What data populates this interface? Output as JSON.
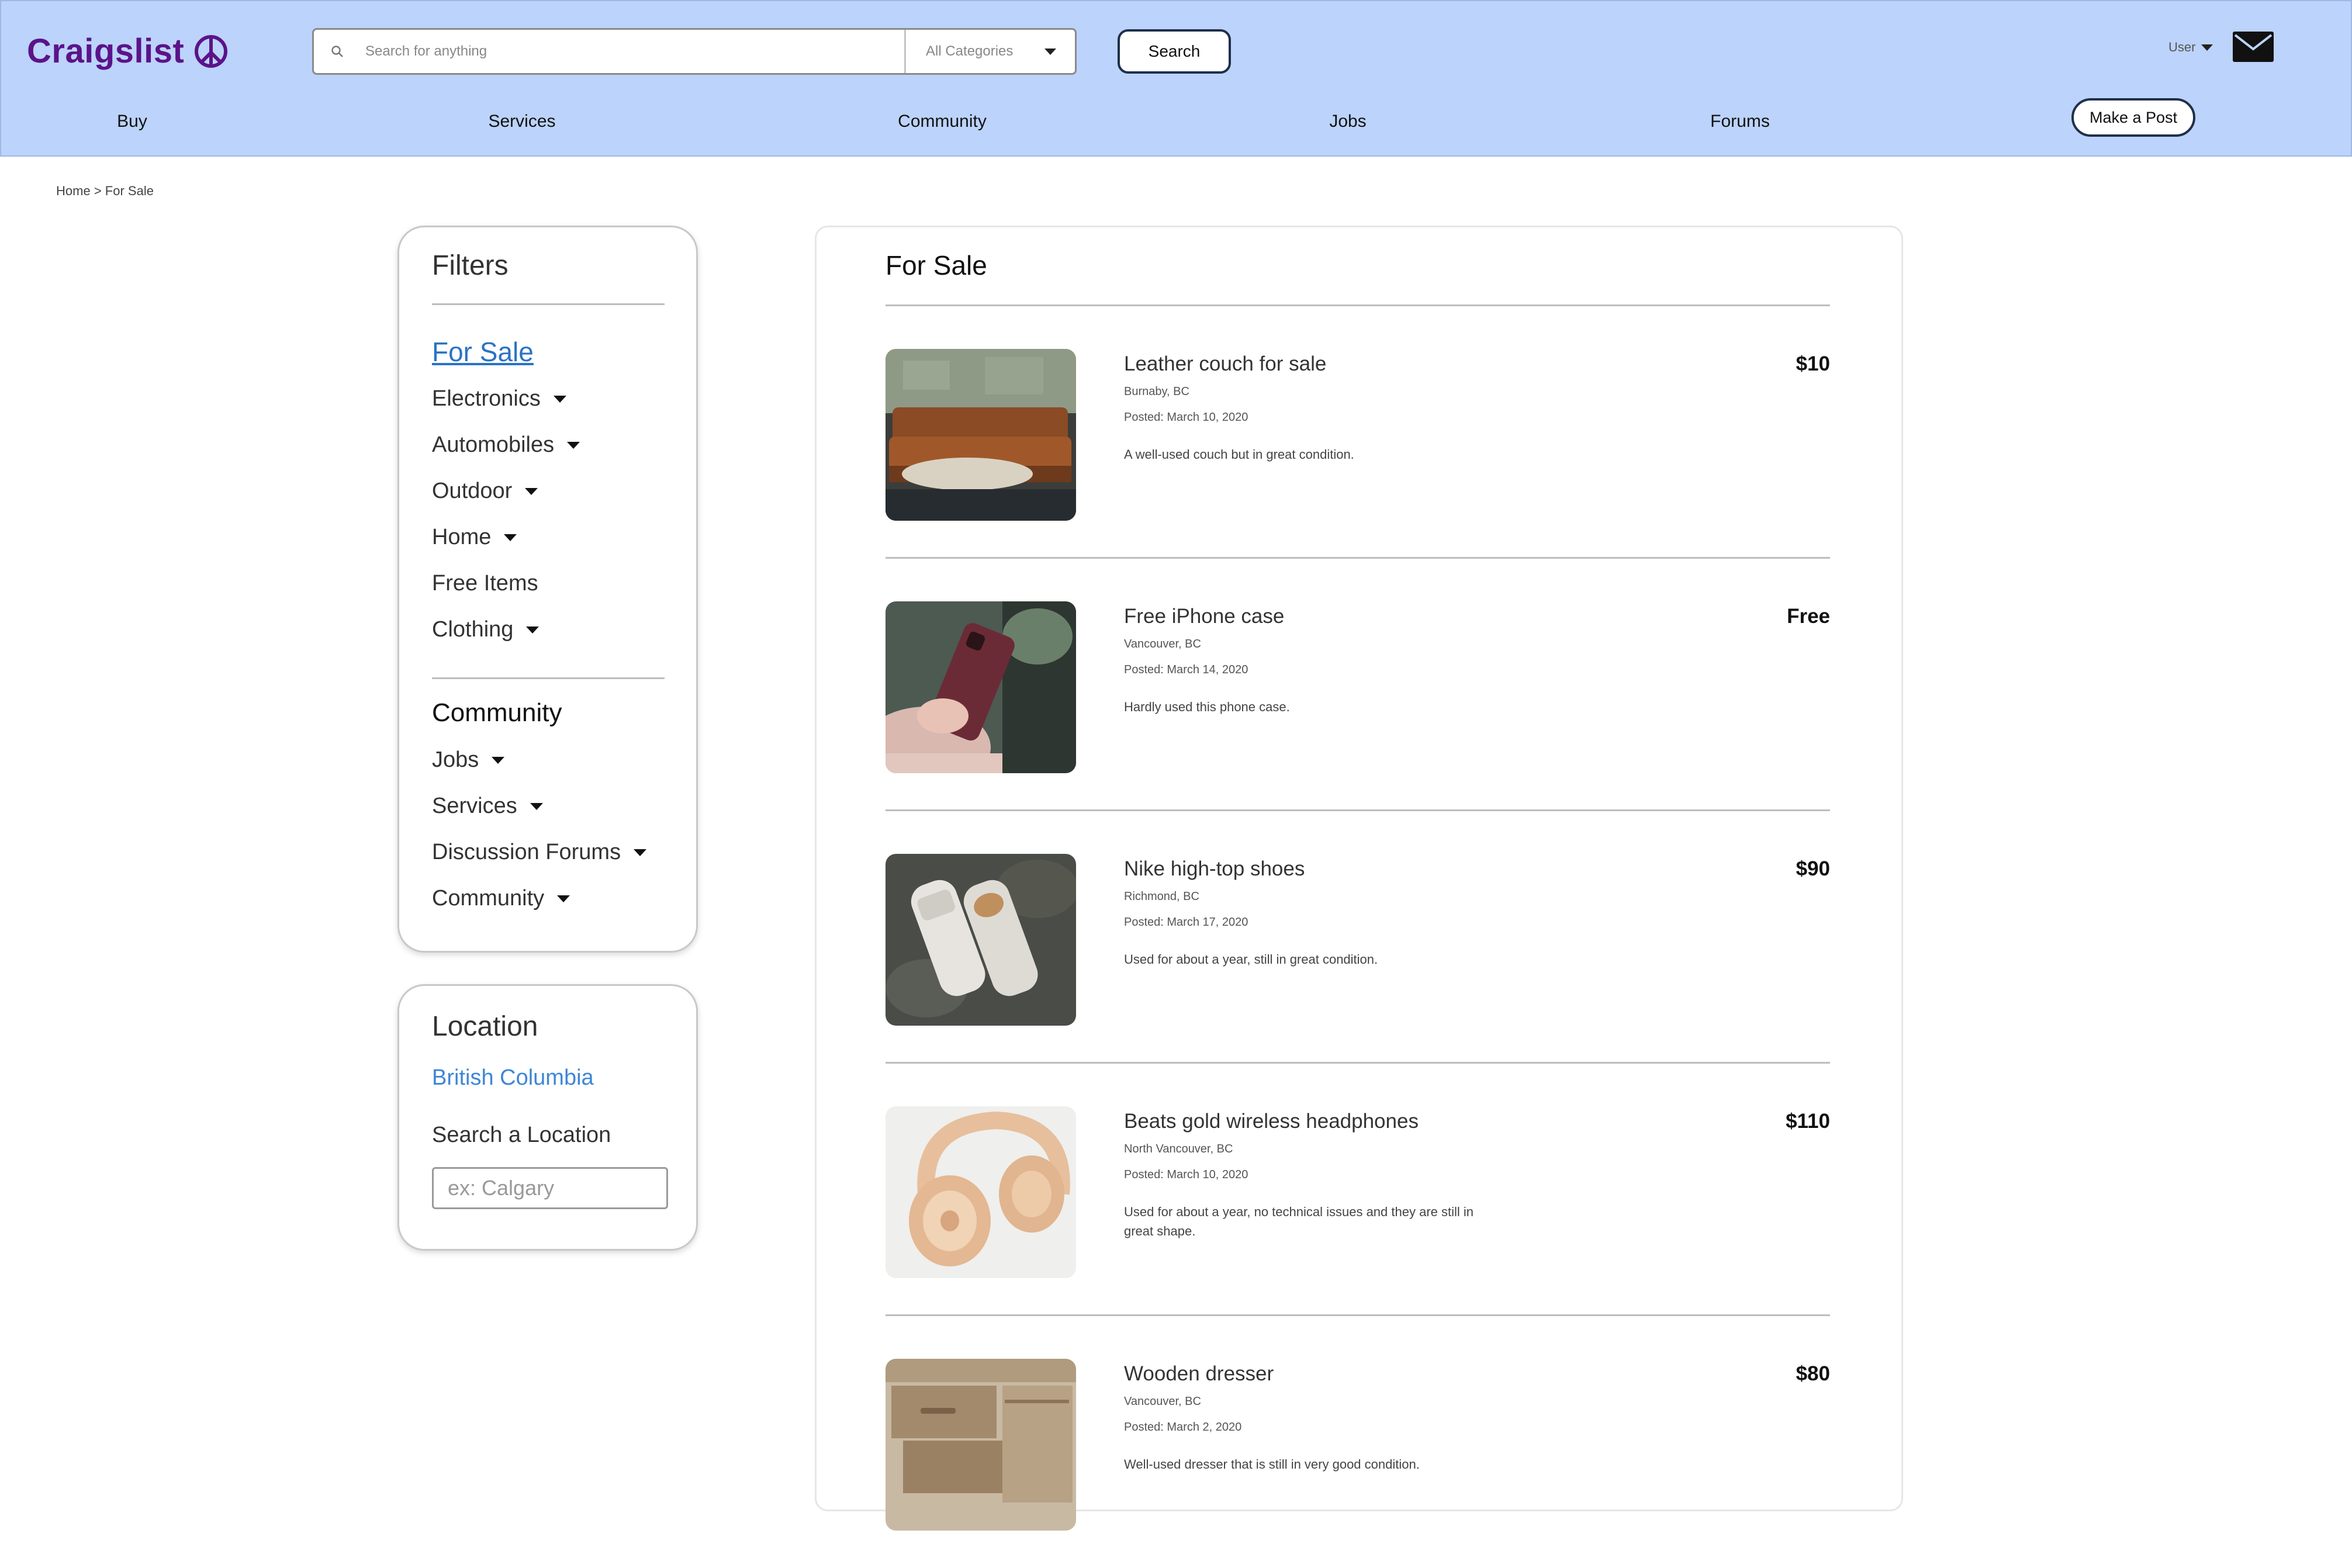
{
  "header": {
    "logo_text": "Craigslist",
    "search": {
      "placeholder": "Search for anything",
      "value": ""
    },
    "category_select": "All Categories",
    "search_button": "Search",
    "user_menu": "User",
    "post_button": "Make a Post",
    "background": "#bcd3fb",
    "brand_color": "#5b138a"
  },
  "nav": {
    "items": [
      "Buy",
      "Services",
      "Community",
      "Jobs",
      "Forums"
    ]
  },
  "breadcrumb": {
    "home": "Home",
    "separator": ">",
    "current": "For Sale"
  },
  "filters": {
    "title": "Filters",
    "active_category": "For Sale",
    "sale_items": [
      {
        "label": "Electronics",
        "expandable": true
      },
      {
        "label": "Automobiles",
        "expandable": true
      },
      {
        "label": "Outdoor",
        "expandable": true
      },
      {
        "label": "Home",
        "expandable": true
      },
      {
        "label": "Free Items",
        "expandable": false
      },
      {
        "label": "Clothing",
        "expandable": true
      }
    ],
    "community_heading": "Community",
    "community_items": [
      {
        "label": "Jobs",
        "expandable": true
      },
      {
        "label": "Services",
        "expandable": true
      },
      {
        "label": "Discussion Forums",
        "expandable": true
      },
      {
        "label": "Community",
        "expandable": true
      }
    ]
  },
  "location": {
    "title": "Location",
    "current": "British Columbia",
    "search_label": "Search a Location",
    "input_placeholder": "ex: Calgary",
    "input_value": ""
  },
  "results": {
    "title": "For Sale",
    "listings": [
      {
        "title": "Leather couch for sale",
        "price": "$10",
        "location": "Burnaby, BC",
        "posted": "Posted: March 10, 2020",
        "description": "A well-used couch but in great condition.",
        "image": "couch-photo"
      },
      {
        "title": "Free iPhone case",
        "price": "Free",
        "location": "Vancouver, BC",
        "posted": "Posted: March 14, 2020",
        "description": "Hardly used this phone case.",
        "image": "phone-case-photo"
      },
      {
        "title": "Nike high-top shoes",
        "price": "$90",
        "location": "Richmond, BC",
        "posted": "Posted: March 17, 2020",
        "description": "Used for about a year, still in great condition.",
        "image": "shoes-photo"
      },
      {
        "title": "Beats gold wireless headphones",
        "price": "$110",
        "location": "North Vancouver, BC",
        "posted": "Posted: March 10, 2020",
        "description": "Used for about a year, no technical issues and they are still in great shape.",
        "image": "headphones-photo"
      },
      {
        "title": "Wooden dresser",
        "price": "$80",
        "location": "Vancouver, BC",
        "posted": "Posted: March 2, 2020",
        "description": "Well-used dresser that is still in very good condition.",
        "image": "dresser-photo"
      }
    ]
  },
  "icons": {
    "logo": "peace-sign-icon",
    "search": "search-icon",
    "dropdown": "chevron-down-icon",
    "mail": "mail-icon"
  }
}
